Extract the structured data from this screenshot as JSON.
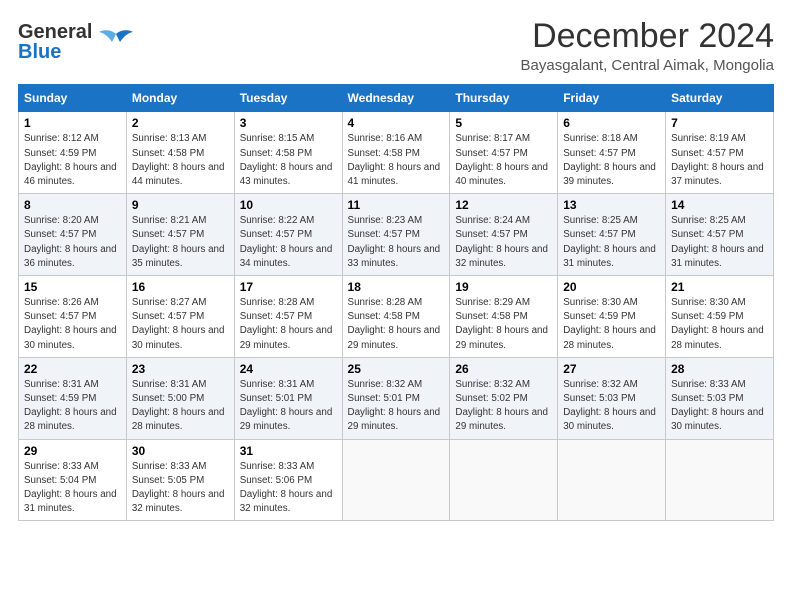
{
  "header": {
    "logo_line1": "General",
    "logo_line2": "Blue",
    "title": "December 2024",
    "subtitle": "Bayasgalant, Central Aimak, Mongolia"
  },
  "weekdays": [
    "Sunday",
    "Monday",
    "Tuesday",
    "Wednesday",
    "Thursday",
    "Friday",
    "Saturday"
  ],
  "weeks": [
    [
      {
        "day": "1",
        "sunrise": "Sunrise: 8:12 AM",
        "sunset": "Sunset: 4:59 PM",
        "daylight": "Daylight: 8 hours and 46 minutes."
      },
      {
        "day": "2",
        "sunrise": "Sunrise: 8:13 AM",
        "sunset": "Sunset: 4:58 PM",
        "daylight": "Daylight: 8 hours and 44 minutes."
      },
      {
        "day": "3",
        "sunrise": "Sunrise: 8:15 AM",
        "sunset": "Sunset: 4:58 PM",
        "daylight": "Daylight: 8 hours and 43 minutes."
      },
      {
        "day": "4",
        "sunrise": "Sunrise: 8:16 AM",
        "sunset": "Sunset: 4:58 PM",
        "daylight": "Daylight: 8 hours and 41 minutes."
      },
      {
        "day": "5",
        "sunrise": "Sunrise: 8:17 AM",
        "sunset": "Sunset: 4:57 PM",
        "daylight": "Daylight: 8 hours and 40 minutes."
      },
      {
        "day": "6",
        "sunrise": "Sunrise: 8:18 AM",
        "sunset": "Sunset: 4:57 PM",
        "daylight": "Daylight: 8 hours and 39 minutes."
      },
      {
        "day": "7",
        "sunrise": "Sunrise: 8:19 AM",
        "sunset": "Sunset: 4:57 PM",
        "daylight": "Daylight: 8 hours and 37 minutes."
      }
    ],
    [
      {
        "day": "8",
        "sunrise": "Sunrise: 8:20 AM",
        "sunset": "Sunset: 4:57 PM",
        "daylight": "Daylight: 8 hours and 36 minutes."
      },
      {
        "day": "9",
        "sunrise": "Sunrise: 8:21 AM",
        "sunset": "Sunset: 4:57 PM",
        "daylight": "Daylight: 8 hours and 35 minutes."
      },
      {
        "day": "10",
        "sunrise": "Sunrise: 8:22 AM",
        "sunset": "Sunset: 4:57 PM",
        "daylight": "Daylight: 8 hours and 34 minutes."
      },
      {
        "day": "11",
        "sunrise": "Sunrise: 8:23 AM",
        "sunset": "Sunset: 4:57 PM",
        "daylight": "Daylight: 8 hours and 33 minutes."
      },
      {
        "day": "12",
        "sunrise": "Sunrise: 8:24 AM",
        "sunset": "Sunset: 4:57 PM",
        "daylight": "Daylight: 8 hours and 32 minutes."
      },
      {
        "day": "13",
        "sunrise": "Sunrise: 8:25 AM",
        "sunset": "Sunset: 4:57 PM",
        "daylight": "Daylight: 8 hours and 31 minutes."
      },
      {
        "day": "14",
        "sunrise": "Sunrise: 8:25 AM",
        "sunset": "Sunset: 4:57 PM",
        "daylight": "Daylight: 8 hours and 31 minutes."
      }
    ],
    [
      {
        "day": "15",
        "sunrise": "Sunrise: 8:26 AM",
        "sunset": "Sunset: 4:57 PM",
        "daylight": "Daylight: 8 hours and 30 minutes."
      },
      {
        "day": "16",
        "sunrise": "Sunrise: 8:27 AM",
        "sunset": "Sunset: 4:57 PM",
        "daylight": "Daylight: 8 hours and 30 minutes."
      },
      {
        "day": "17",
        "sunrise": "Sunrise: 8:28 AM",
        "sunset": "Sunset: 4:57 PM",
        "daylight": "Daylight: 8 hours and 29 minutes."
      },
      {
        "day": "18",
        "sunrise": "Sunrise: 8:28 AM",
        "sunset": "Sunset: 4:58 PM",
        "daylight": "Daylight: 8 hours and 29 minutes."
      },
      {
        "day": "19",
        "sunrise": "Sunrise: 8:29 AM",
        "sunset": "Sunset: 4:58 PM",
        "daylight": "Daylight: 8 hours and 29 minutes."
      },
      {
        "day": "20",
        "sunrise": "Sunrise: 8:30 AM",
        "sunset": "Sunset: 4:59 PM",
        "daylight": "Daylight: 8 hours and 28 minutes."
      },
      {
        "day": "21",
        "sunrise": "Sunrise: 8:30 AM",
        "sunset": "Sunset: 4:59 PM",
        "daylight": "Daylight: 8 hours and 28 minutes."
      }
    ],
    [
      {
        "day": "22",
        "sunrise": "Sunrise: 8:31 AM",
        "sunset": "Sunset: 4:59 PM",
        "daylight": "Daylight: 8 hours and 28 minutes."
      },
      {
        "day": "23",
        "sunrise": "Sunrise: 8:31 AM",
        "sunset": "Sunset: 5:00 PM",
        "daylight": "Daylight: 8 hours and 28 minutes."
      },
      {
        "day": "24",
        "sunrise": "Sunrise: 8:31 AM",
        "sunset": "Sunset: 5:01 PM",
        "daylight": "Daylight: 8 hours and 29 minutes."
      },
      {
        "day": "25",
        "sunrise": "Sunrise: 8:32 AM",
        "sunset": "Sunset: 5:01 PM",
        "daylight": "Daylight: 8 hours and 29 minutes."
      },
      {
        "day": "26",
        "sunrise": "Sunrise: 8:32 AM",
        "sunset": "Sunset: 5:02 PM",
        "daylight": "Daylight: 8 hours and 29 minutes."
      },
      {
        "day": "27",
        "sunrise": "Sunrise: 8:32 AM",
        "sunset": "Sunset: 5:03 PM",
        "daylight": "Daylight: 8 hours and 30 minutes."
      },
      {
        "day": "28",
        "sunrise": "Sunrise: 8:33 AM",
        "sunset": "Sunset: 5:03 PM",
        "daylight": "Daylight: 8 hours and 30 minutes."
      }
    ],
    [
      {
        "day": "29",
        "sunrise": "Sunrise: 8:33 AM",
        "sunset": "Sunset: 5:04 PM",
        "daylight": "Daylight: 8 hours and 31 minutes."
      },
      {
        "day": "30",
        "sunrise": "Sunrise: 8:33 AM",
        "sunset": "Sunset: 5:05 PM",
        "daylight": "Daylight: 8 hours and 32 minutes."
      },
      {
        "day": "31",
        "sunrise": "Sunrise: 8:33 AM",
        "sunset": "Sunset: 5:06 PM",
        "daylight": "Daylight: 8 hours and 32 minutes."
      },
      null,
      null,
      null,
      null
    ]
  ]
}
